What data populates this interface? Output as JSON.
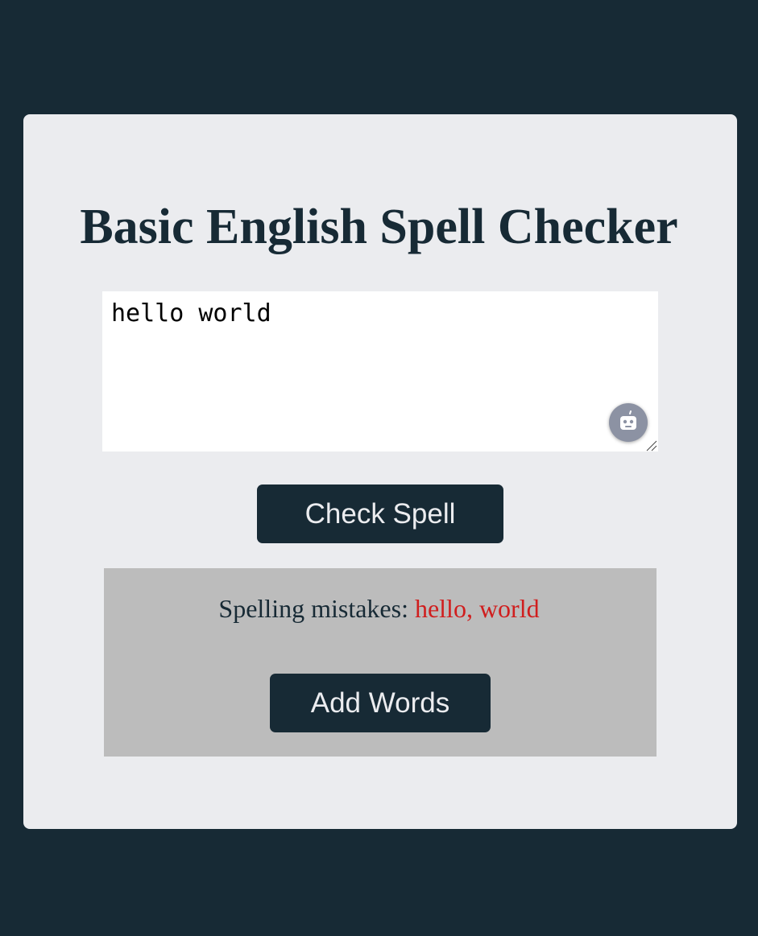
{
  "header": {
    "title": "Basic English Spell Checker"
  },
  "editor": {
    "text": "hello world"
  },
  "buttons": {
    "check_spell": "Check Spell",
    "add_words": "Add Words"
  },
  "result": {
    "label": "Spelling mistakes:",
    "words": "hello, world"
  },
  "icons": {
    "grammar_assistant": "robot-icon",
    "resize": "resize-handle-icon"
  },
  "colors": {
    "page_background": "#172a35",
    "card_background": "#ebecef",
    "button_background": "#172a35",
    "button_text": "#ebecef",
    "result_background": "#bcbcbc",
    "mistake_text": "#d01e1e"
  }
}
